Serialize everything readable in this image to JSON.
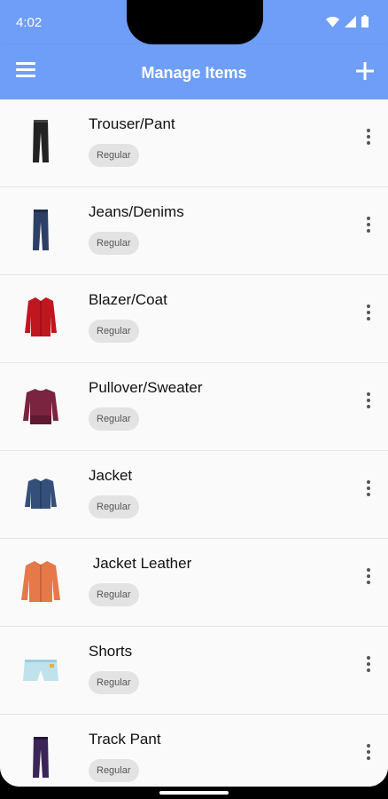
{
  "status": {
    "time": "4:02",
    "icons": [
      "wifi-icon",
      "signal-icon",
      "battery-icon"
    ]
  },
  "appbar": {
    "title": "Manage Items",
    "menu_icon": "hamburger-menu-icon",
    "add_icon": "plus-icon"
  },
  "colors": {
    "primary": "#6f9ef8",
    "chip_bg": "#e3e3e3"
  },
  "items": [
    {
      "name": "Trouser/Pant",
      "tag": "Regular",
      "icon": "black-trouser-icon"
    },
    {
      "name": "Jeans/Denims",
      "tag": "Regular",
      "icon": "blue-jeans-icon"
    },
    {
      "name": "Blazer/Coat",
      "tag": "Regular",
      "icon": "red-blazer-icon"
    },
    {
      "name": "Pullover/Sweater",
      "tag": "Regular",
      "icon": "maroon-sweater-icon"
    },
    {
      "name": "Jacket",
      "tag": "Regular",
      "icon": "denim-jacket-icon"
    },
    {
      "name": " Jacket Leather",
      "tag": "Regular",
      "icon": "orange-leather-jacket-icon"
    },
    {
      "name": "Shorts",
      "tag": "Regular",
      "icon": "light-blue-shorts-icon"
    },
    {
      "name": "Track Pant",
      "tag": "Regular",
      "icon": "purple-track-pant-icon"
    }
  ]
}
